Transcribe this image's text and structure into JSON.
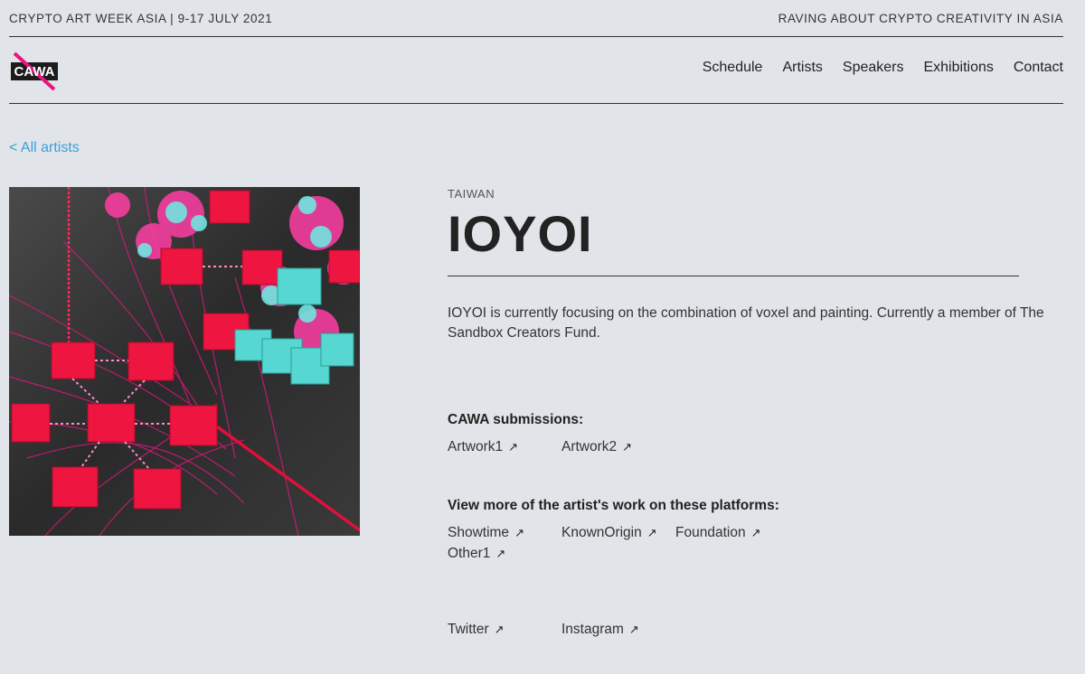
{
  "topbar": {
    "left": "CRYPTO ART WEEK ASIA | 9-17 JULY 2021",
    "right": "RAVING ABOUT CRYPTO CREATIVITY IN ASIA"
  },
  "logo": {
    "text": "CAWA",
    "accent": "#e8177d"
  },
  "nav": {
    "items": [
      "Schedule",
      "Artists",
      "Speakers",
      "Exhibitions",
      "Contact"
    ]
  },
  "back_link": "< All artists",
  "artist": {
    "country": "TAIWAN",
    "name": "IOYOI",
    "bio": "IOYOI is currently focusing on the combination of voxel and painting. Currently a member of The Sandbox Creators Fund."
  },
  "submissions": {
    "title": "CAWA submissions:",
    "links": [
      "Artwork1",
      "Artwork2"
    ]
  },
  "platforms": {
    "title": "View more of the artist's work on these platforms:",
    "links": [
      "Showtime",
      "KnownOrigin",
      "Foundation",
      "Other1"
    ]
  },
  "social": {
    "links": [
      "Twitter",
      "Instagram"
    ]
  },
  "icons": {
    "external": "north-east-arrow-icon"
  },
  "colors": {
    "background": "#e1e4e8",
    "link_blue": "#3aa0dc",
    "magenta": "#e8177d",
    "cube_red": "#f0153e",
    "cyan": "#55d6d0"
  }
}
